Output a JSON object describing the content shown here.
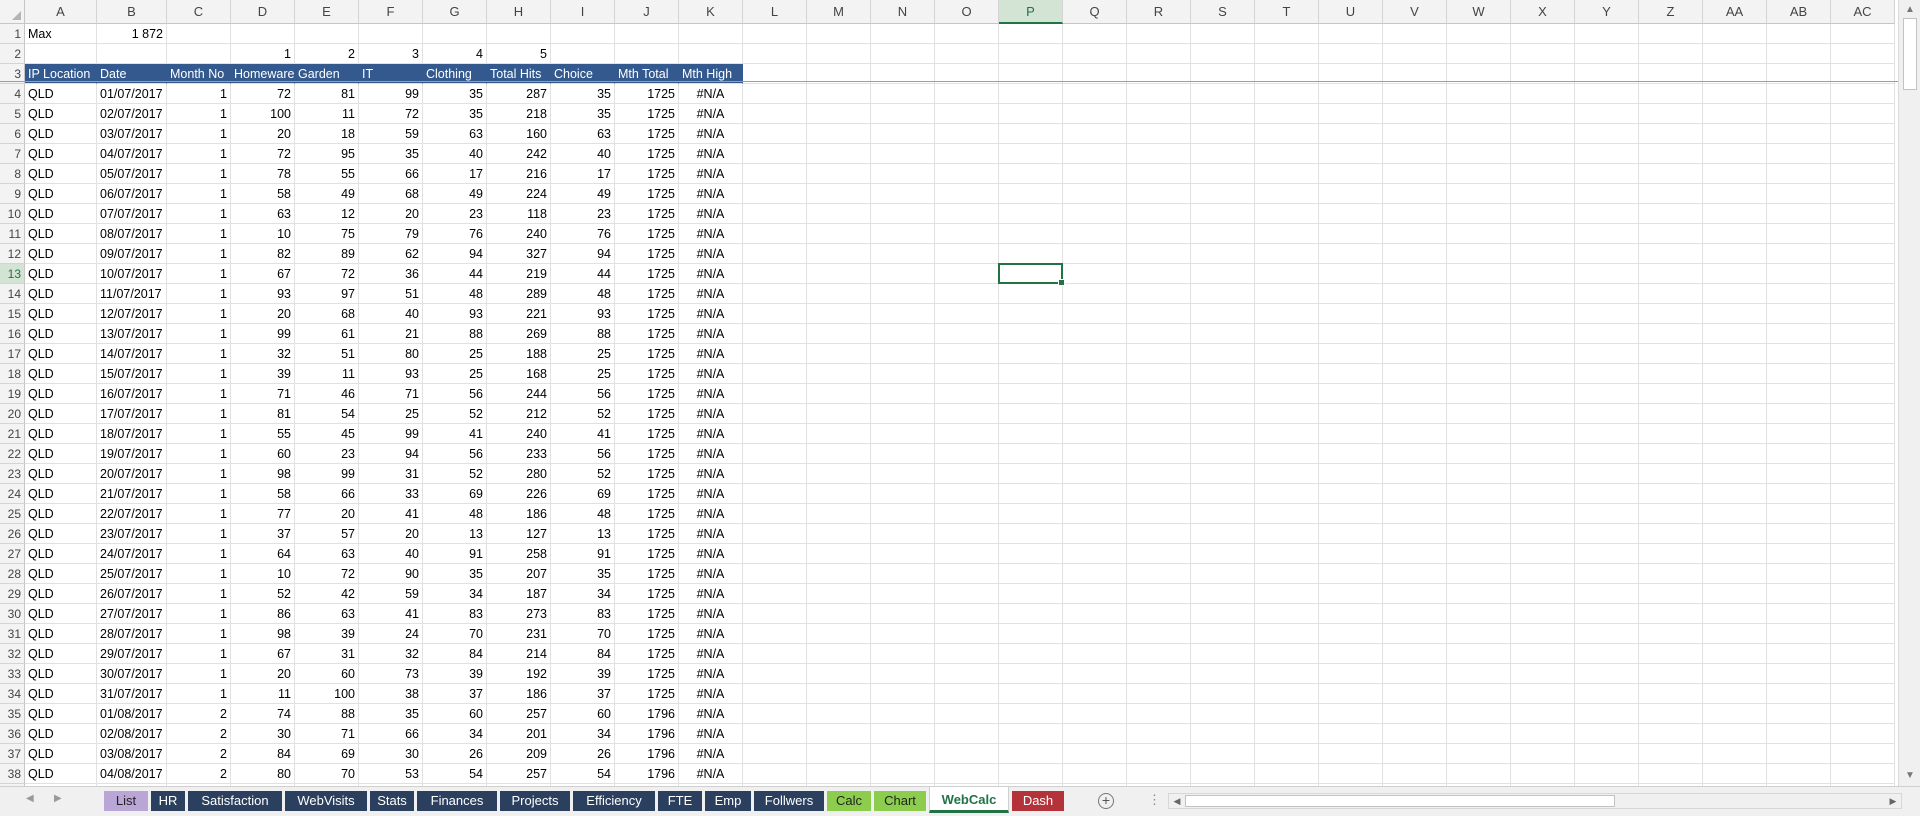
{
  "columns": [
    "A",
    "B",
    "C",
    "D",
    "E",
    "F",
    "G",
    "H",
    "I",
    "J",
    "K",
    "L",
    "M",
    "N",
    "O",
    "P",
    "Q",
    "R",
    "S",
    "T",
    "U",
    "V",
    "W",
    "X",
    "Y",
    "Z",
    "AA",
    "AB",
    "AC"
  ],
  "selected_column": "P",
  "selected_row": 13,
  "row1": {
    "label": "Max",
    "value": "1 872"
  },
  "row2": {
    "D": "1",
    "E": "2",
    "F": "3",
    "G": "4",
    "H": "5"
  },
  "headers": [
    "IP Location",
    "Date",
    "Month No",
    "Homeware",
    "Garden",
    "IT",
    "Clothing",
    "Total Hits",
    "Choice",
    "Mth Total",
    "Mth High"
  ],
  "rows": [
    [
      "QLD",
      "01/07/2017",
      "1",
      "72",
      "81",
      "99",
      "35",
      "287",
      "35",
      "1725",
      "#N/A"
    ],
    [
      "QLD",
      "02/07/2017",
      "1",
      "100",
      "11",
      "72",
      "35",
      "218",
      "35",
      "1725",
      "#N/A"
    ],
    [
      "QLD",
      "03/07/2017",
      "1",
      "20",
      "18",
      "59",
      "63",
      "160",
      "63",
      "1725",
      "#N/A"
    ],
    [
      "QLD",
      "04/07/2017",
      "1",
      "72",
      "95",
      "35",
      "40",
      "242",
      "40",
      "1725",
      "#N/A"
    ],
    [
      "QLD",
      "05/07/2017",
      "1",
      "78",
      "55",
      "66",
      "17",
      "216",
      "17",
      "1725",
      "#N/A"
    ],
    [
      "QLD",
      "06/07/2017",
      "1",
      "58",
      "49",
      "68",
      "49",
      "224",
      "49",
      "1725",
      "#N/A"
    ],
    [
      "QLD",
      "07/07/2017",
      "1",
      "63",
      "12",
      "20",
      "23",
      "118",
      "23",
      "1725",
      "#N/A"
    ],
    [
      "QLD",
      "08/07/2017",
      "1",
      "10",
      "75",
      "79",
      "76",
      "240",
      "76",
      "1725",
      "#N/A"
    ],
    [
      "QLD",
      "09/07/2017",
      "1",
      "82",
      "89",
      "62",
      "94",
      "327",
      "94",
      "1725",
      "#N/A"
    ],
    [
      "QLD",
      "10/07/2017",
      "1",
      "67",
      "72",
      "36",
      "44",
      "219",
      "44",
      "1725",
      "#N/A"
    ],
    [
      "QLD",
      "11/07/2017",
      "1",
      "93",
      "97",
      "51",
      "48",
      "289",
      "48",
      "1725",
      "#N/A"
    ],
    [
      "QLD",
      "12/07/2017",
      "1",
      "20",
      "68",
      "40",
      "93",
      "221",
      "93",
      "1725",
      "#N/A"
    ],
    [
      "QLD",
      "13/07/2017",
      "1",
      "99",
      "61",
      "21",
      "88",
      "269",
      "88",
      "1725",
      "#N/A"
    ],
    [
      "QLD",
      "14/07/2017",
      "1",
      "32",
      "51",
      "80",
      "25",
      "188",
      "25",
      "1725",
      "#N/A"
    ],
    [
      "QLD",
      "15/07/2017",
      "1",
      "39",
      "11",
      "93",
      "25",
      "168",
      "25",
      "1725",
      "#N/A"
    ],
    [
      "QLD",
      "16/07/2017",
      "1",
      "71",
      "46",
      "71",
      "56",
      "244",
      "56",
      "1725",
      "#N/A"
    ],
    [
      "QLD",
      "17/07/2017",
      "1",
      "81",
      "54",
      "25",
      "52",
      "212",
      "52",
      "1725",
      "#N/A"
    ],
    [
      "QLD",
      "18/07/2017",
      "1",
      "55",
      "45",
      "99",
      "41",
      "240",
      "41",
      "1725",
      "#N/A"
    ],
    [
      "QLD",
      "19/07/2017",
      "1",
      "60",
      "23",
      "94",
      "56",
      "233",
      "56",
      "1725",
      "#N/A"
    ],
    [
      "QLD",
      "20/07/2017",
      "1",
      "98",
      "99",
      "31",
      "52",
      "280",
      "52",
      "1725",
      "#N/A"
    ],
    [
      "QLD",
      "21/07/2017",
      "1",
      "58",
      "66",
      "33",
      "69",
      "226",
      "69",
      "1725",
      "#N/A"
    ],
    [
      "QLD",
      "22/07/2017",
      "1",
      "77",
      "20",
      "41",
      "48",
      "186",
      "48",
      "1725",
      "#N/A"
    ],
    [
      "QLD",
      "23/07/2017",
      "1",
      "37",
      "57",
      "20",
      "13",
      "127",
      "13",
      "1725",
      "#N/A"
    ],
    [
      "QLD",
      "24/07/2017",
      "1",
      "64",
      "63",
      "40",
      "91",
      "258",
      "91",
      "1725",
      "#N/A"
    ],
    [
      "QLD",
      "25/07/2017",
      "1",
      "10",
      "72",
      "90",
      "35",
      "207",
      "35",
      "1725",
      "#N/A"
    ],
    [
      "QLD",
      "26/07/2017",
      "1",
      "52",
      "42",
      "59",
      "34",
      "187",
      "34",
      "1725",
      "#N/A"
    ],
    [
      "QLD",
      "27/07/2017",
      "1",
      "86",
      "63",
      "41",
      "83",
      "273",
      "83",
      "1725",
      "#N/A"
    ],
    [
      "QLD",
      "28/07/2017",
      "1",
      "98",
      "39",
      "24",
      "70",
      "231",
      "70",
      "1725",
      "#N/A"
    ],
    [
      "QLD",
      "29/07/2017",
      "1",
      "67",
      "31",
      "32",
      "84",
      "214",
      "84",
      "1725",
      "#N/A"
    ],
    [
      "QLD",
      "30/07/2017",
      "1",
      "20",
      "60",
      "73",
      "39",
      "192",
      "39",
      "1725",
      "#N/A"
    ],
    [
      "QLD",
      "31/07/2017",
      "1",
      "11",
      "100",
      "38",
      "37",
      "186",
      "37",
      "1725",
      "#N/A"
    ],
    [
      "QLD",
      "01/08/2017",
      "2",
      "74",
      "88",
      "35",
      "60",
      "257",
      "60",
      "1796",
      "#N/A"
    ],
    [
      "QLD",
      "02/08/2017",
      "2",
      "30",
      "71",
      "66",
      "34",
      "201",
      "34",
      "1796",
      "#N/A"
    ],
    [
      "QLD",
      "03/08/2017",
      "2",
      "84",
      "69",
      "30",
      "26",
      "209",
      "26",
      "1796",
      "#N/A"
    ],
    [
      "QLD",
      "04/08/2017",
      "2",
      "80",
      "70",
      "53",
      "54",
      "257",
      "54",
      "1796",
      "#N/A"
    ]
  ],
  "colors": {
    "header_fill": "#33598f",
    "selection": "#217346"
  },
  "sheet_tabs": [
    {
      "name": "List",
      "bg": "#b9a6d6",
      "fg": "#222222",
      "active": false
    },
    {
      "name": "HR",
      "bg": "#2b3f5e",
      "fg": "#ffffff",
      "active": false
    },
    {
      "name": "Satisfaction",
      "bg": "#2b3f5e",
      "fg": "#ffffff",
      "active": false
    },
    {
      "name": "WebVisits",
      "bg": "#2b3f5e",
      "fg": "#ffffff",
      "active": false
    },
    {
      "name": "Stats",
      "bg": "#2b3f5e",
      "fg": "#ffffff",
      "active": false
    },
    {
      "name": "Finances",
      "bg": "#2b3f5e",
      "fg": "#ffffff",
      "active": false
    },
    {
      "name": "Projects",
      "bg": "#2b3f5e",
      "fg": "#ffffff",
      "active": false
    },
    {
      "name": "Efficiency",
      "bg": "#2b3f5e",
      "fg": "#ffffff",
      "active": false
    },
    {
      "name": "FTE",
      "bg": "#2b3f5e",
      "fg": "#ffffff",
      "active": false
    },
    {
      "name": "Emp",
      "bg": "#2b3f5e",
      "fg": "#ffffff",
      "active": false
    },
    {
      "name": "Follwers",
      "bg": "#2b3f5e",
      "fg": "#ffffff",
      "active": false
    },
    {
      "name": "Calc",
      "bg": "#8ccd4e",
      "fg": "#222222",
      "active": false
    },
    {
      "name": "Chart",
      "bg": "#8ccd4e",
      "fg": "#222222",
      "active": false
    },
    {
      "name": "WebCalc",
      "bg": "#ffffff",
      "fg": "#217346",
      "active": true
    },
    {
      "name": "Dash",
      "bg": "#b4333a",
      "fg": "#ffffff",
      "active": false
    }
  ],
  "icons": {
    "add_sheet": "plus-circle-icon",
    "options": "ellipsis-icon",
    "scroll_left": "triangle-left-icon",
    "scroll_right": "triangle-right-icon",
    "scroll_up": "triangle-up-icon",
    "scroll_down": "triangle-down-icon"
  }
}
